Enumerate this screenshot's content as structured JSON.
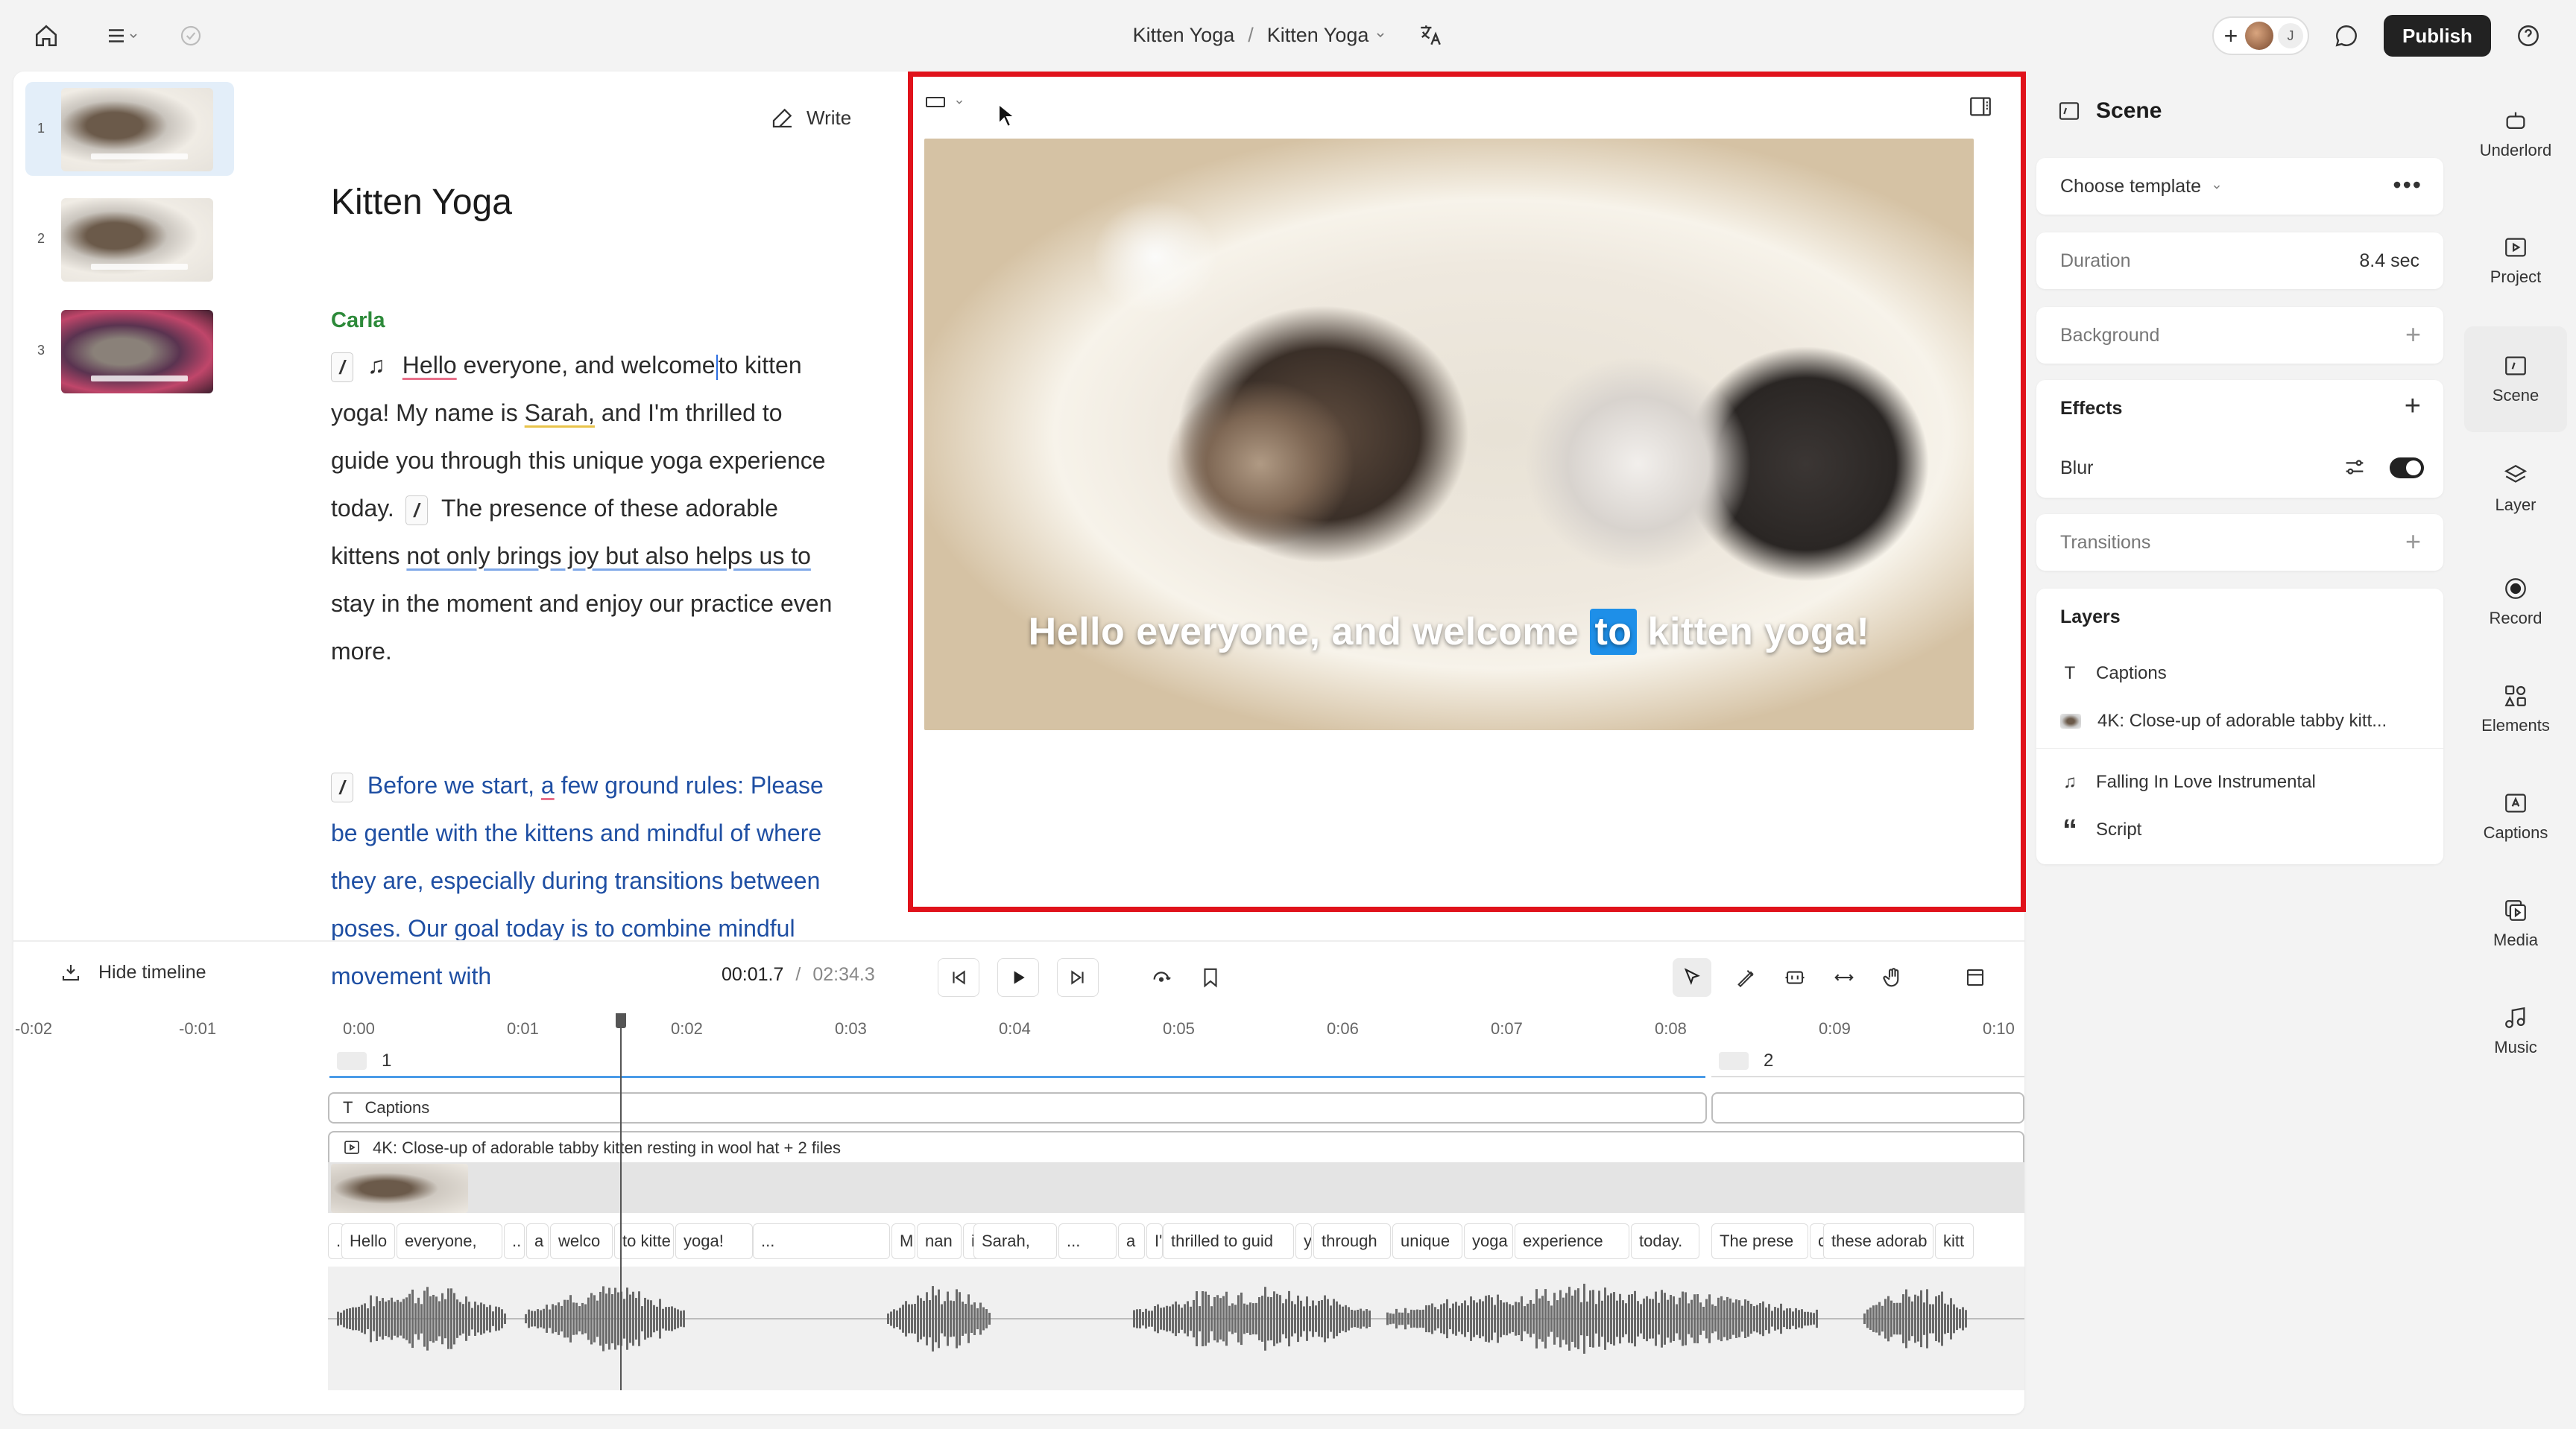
{
  "topbar": {
    "breadcrumb_project": "Kitten Yoga",
    "breadcrumb_sep": "/",
    "breadcrumb_composition": "Kitten Yoga",
    "avatar_initial": "J",
    "publish_label": "Publish"
  },
  "scenes": [
    {
      "number": "1",
      "active": true
    },
    {
      "number": "2",
      "active": false
    },
    {
      "number": "3",
      "active": false
    }
  ],
  "script": {
    "write_label": "Write",
    "title": "Kitten Yoga",
    "speaker": "Carla",
    "slash": "/",
    "music_note": "♫",
    "p1_hello": "Hello",
    "p1_a": "everyone, and welcome",
    "p1_to": "to",
    "p1_b": "kitten yoga!",
    "p1_c": "My name is",
    "p1_sarah": "Sarah,",
    "p1_d": "and I'm thrilled to guide you through this unique yoga experience today.",
    "p1_e": "The presence of these adorable kittens",
    "p1_f": "not only brings joy but also helps us to",
    "p1_g": "stay in the moment and enjoy our practice even more.",
    "p2_a": "Before we start,",
    "p2_b": "a",
    "p2_c": "few ground rules: Please be gentle with the kittens and mindful of where they are, especially during transitions between poses. Our goal today is to combine mindful movement with"
  },
  "preview": {
    "caption_before": "Hello everyone, and welcome",
    "caption_highlight": "to",
    "caption_after": "kitten yoga!"
  },
  "properties": {
    "panel_title": "Scene",
    "template_label": "Choose template",
    "duration_label": "Duration",
    "duration_value": "8.4 sec",
    "background_label": "Background",
    "effects_label": "Effects",
    "blur_label": "Blur",
    "blur_enabled": true,
    "transitions_label": "Transitions",
    "layers_label": "Layers",
    "layers": [
      {
        "icon": "text-icon",
        "label": "Captions"
      },
      {
        "icon": "image-icon",
        "label": "4K: Close-up of adorable tabby kitt..."
      },
      {
        "icon": "music-icon",
        "label": "Falling In Love Instrumental"
      },
      {
        "icon": "quote-icon",
        "label": "Script"
      }
    ]
  },
  "rail": [
    {
      "id": "underlord",
      "label": "Underlord",
      "icon": "robot-icon"
    },
    {
      "id": "project",
      "label": "Project",
      "icon": "folder-play-icon"
    },
    {
      "id": "scene",
      "label": "Scene",
      "icon": "scene-icon",
      "active": true
    },
    {
      "id": "layer",
      "label": "Layer",
      "icon": "layers-icon"
    },
    {
      "id": "record",
      "label": "Record",
      "icon": "record-icon"
    },
    {
      "id": "elements",
      "label": "Elements",
      "icon": "elements-icon"
    },
    {
      "id": "captions",
      "label": "Captions",
      "icon": "captions-icon"
    },
    {
      "id": "media",
      "label": "Media",
      "icon": "media-icon"
    },
    {
      "id": "music",
      "label": "Music",
      "icon": "music-icon"
    }
  ],
  "timeline": {
    "hide_label": "Hide timeline",
    "current_time": "00:01.7",
    "time_sep": "/",
    "total_time": "02:34.3",
    "ruler": [
      "-0:02",
      "-0:01",
      "0:00",
      "0:01",
      "0:02",
      "0:03",
      "0:04",
      "0:05",
      "0:06",
      "0:07",
      "0:08",
      "0:09",
      "0:10"
    ],
    "scene1_label": "1",
    "scene2_label": "2",
    "captions_track": "Captions",
    "media_track": "4K: Close-up of adorable tabby kitten resting in wool hat + 2 files",
    "words": [
      ".",
      "Hello",
      "everyone,",
      "..",
      "a",
      "welco",
      "to kitte",
      "yoga!",
      "...",
      "M",
      "nan",
      "i",
      "Sarah,",
      "...",
      "a",
      "I'",
      "thrilled to guid",
      "y",
      "through",
      "unique",
      "yoga",
      "experience",
      "today.",
      "The prese",
      "c",
      "these adorab",
      "kitt"
    ]
  },
  "colors": {
    "accent": "#1e8fe8",
    "selection_border": "#e0121b",
    "speaker": "#2d8a3a",
    "script_blue": "#1f4fa3",
    "publish_bg": "#222222"
  }
}
